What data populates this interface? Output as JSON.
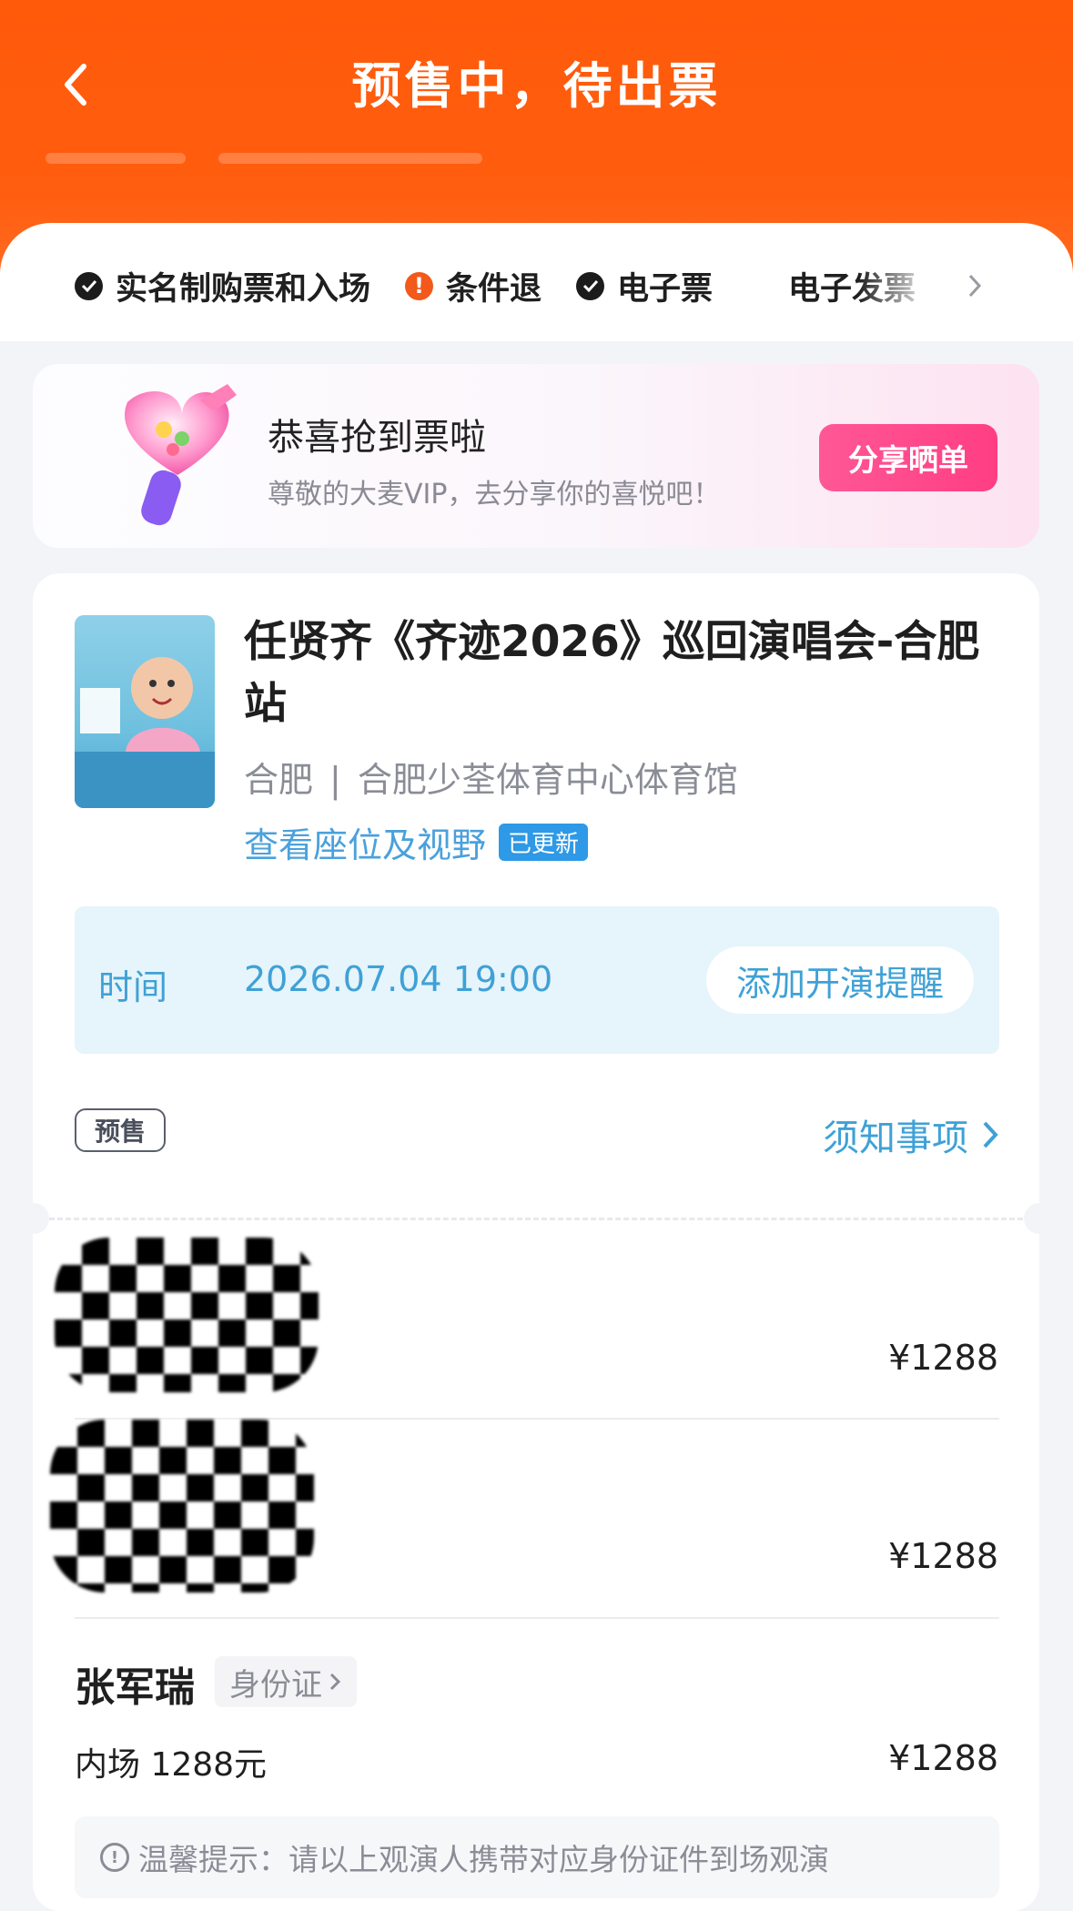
{
  "header": {
    "title": "预售中，待出票"
  },
  "tags": [
    {
      "label": "实名制购票和入场",
      "icon": "check-circle-icon"
    },
    {
      "label": "条件退",
      "icon": "warning-circle-icon"
    },
    {
      "label": "电子票",
      "icon": "check-circle-icon"
    },
    {
      "label": "电子发票",
      "icon": "check-circle-icon"
    }
  ],
  "promo": {
    "title": "恭喜抢到票啦",
    "subtitle": "尊敬的大麦VIP，去分享你的喜悦吧！",
    "button": "分享晒单"
  },
  "event": {
    "title": "任贤齐《齐迹2026》巡回演唱会-合肥站",
    "city": "合肥",
    "separator": "|",
    "venue": "合肥少荃体育中心体育馆",
    "seat_link": "查看座位及视野",
    "updated_badge": "已更新",
    "time_label": "时间",
    "time_value": "2026.07.04 19:00",
    "remind_button": "添加开演提醒",
    "presale_badge": "预售",
    "notice_link": "须知事项"
  },
  "tickets": [
    {
      "price": "¥1288"
    },
    {
      "price": "¥1288"
    },
    {
      "name": "张军瑞",
      "id_type": "身份证",
      "ticket_type": "内场 1288元",
      "price": "¥1288"
    }
  ],
  "tip": {
    "text": "温馨提示：请以上观演人携带对应身份证件到场观演"
  },
  "colors": {
    "header": "#ff5a0a",
    "accent_blue": "#3fa1d6",
    "share_pink": "#ff4a8b"
  }
}
